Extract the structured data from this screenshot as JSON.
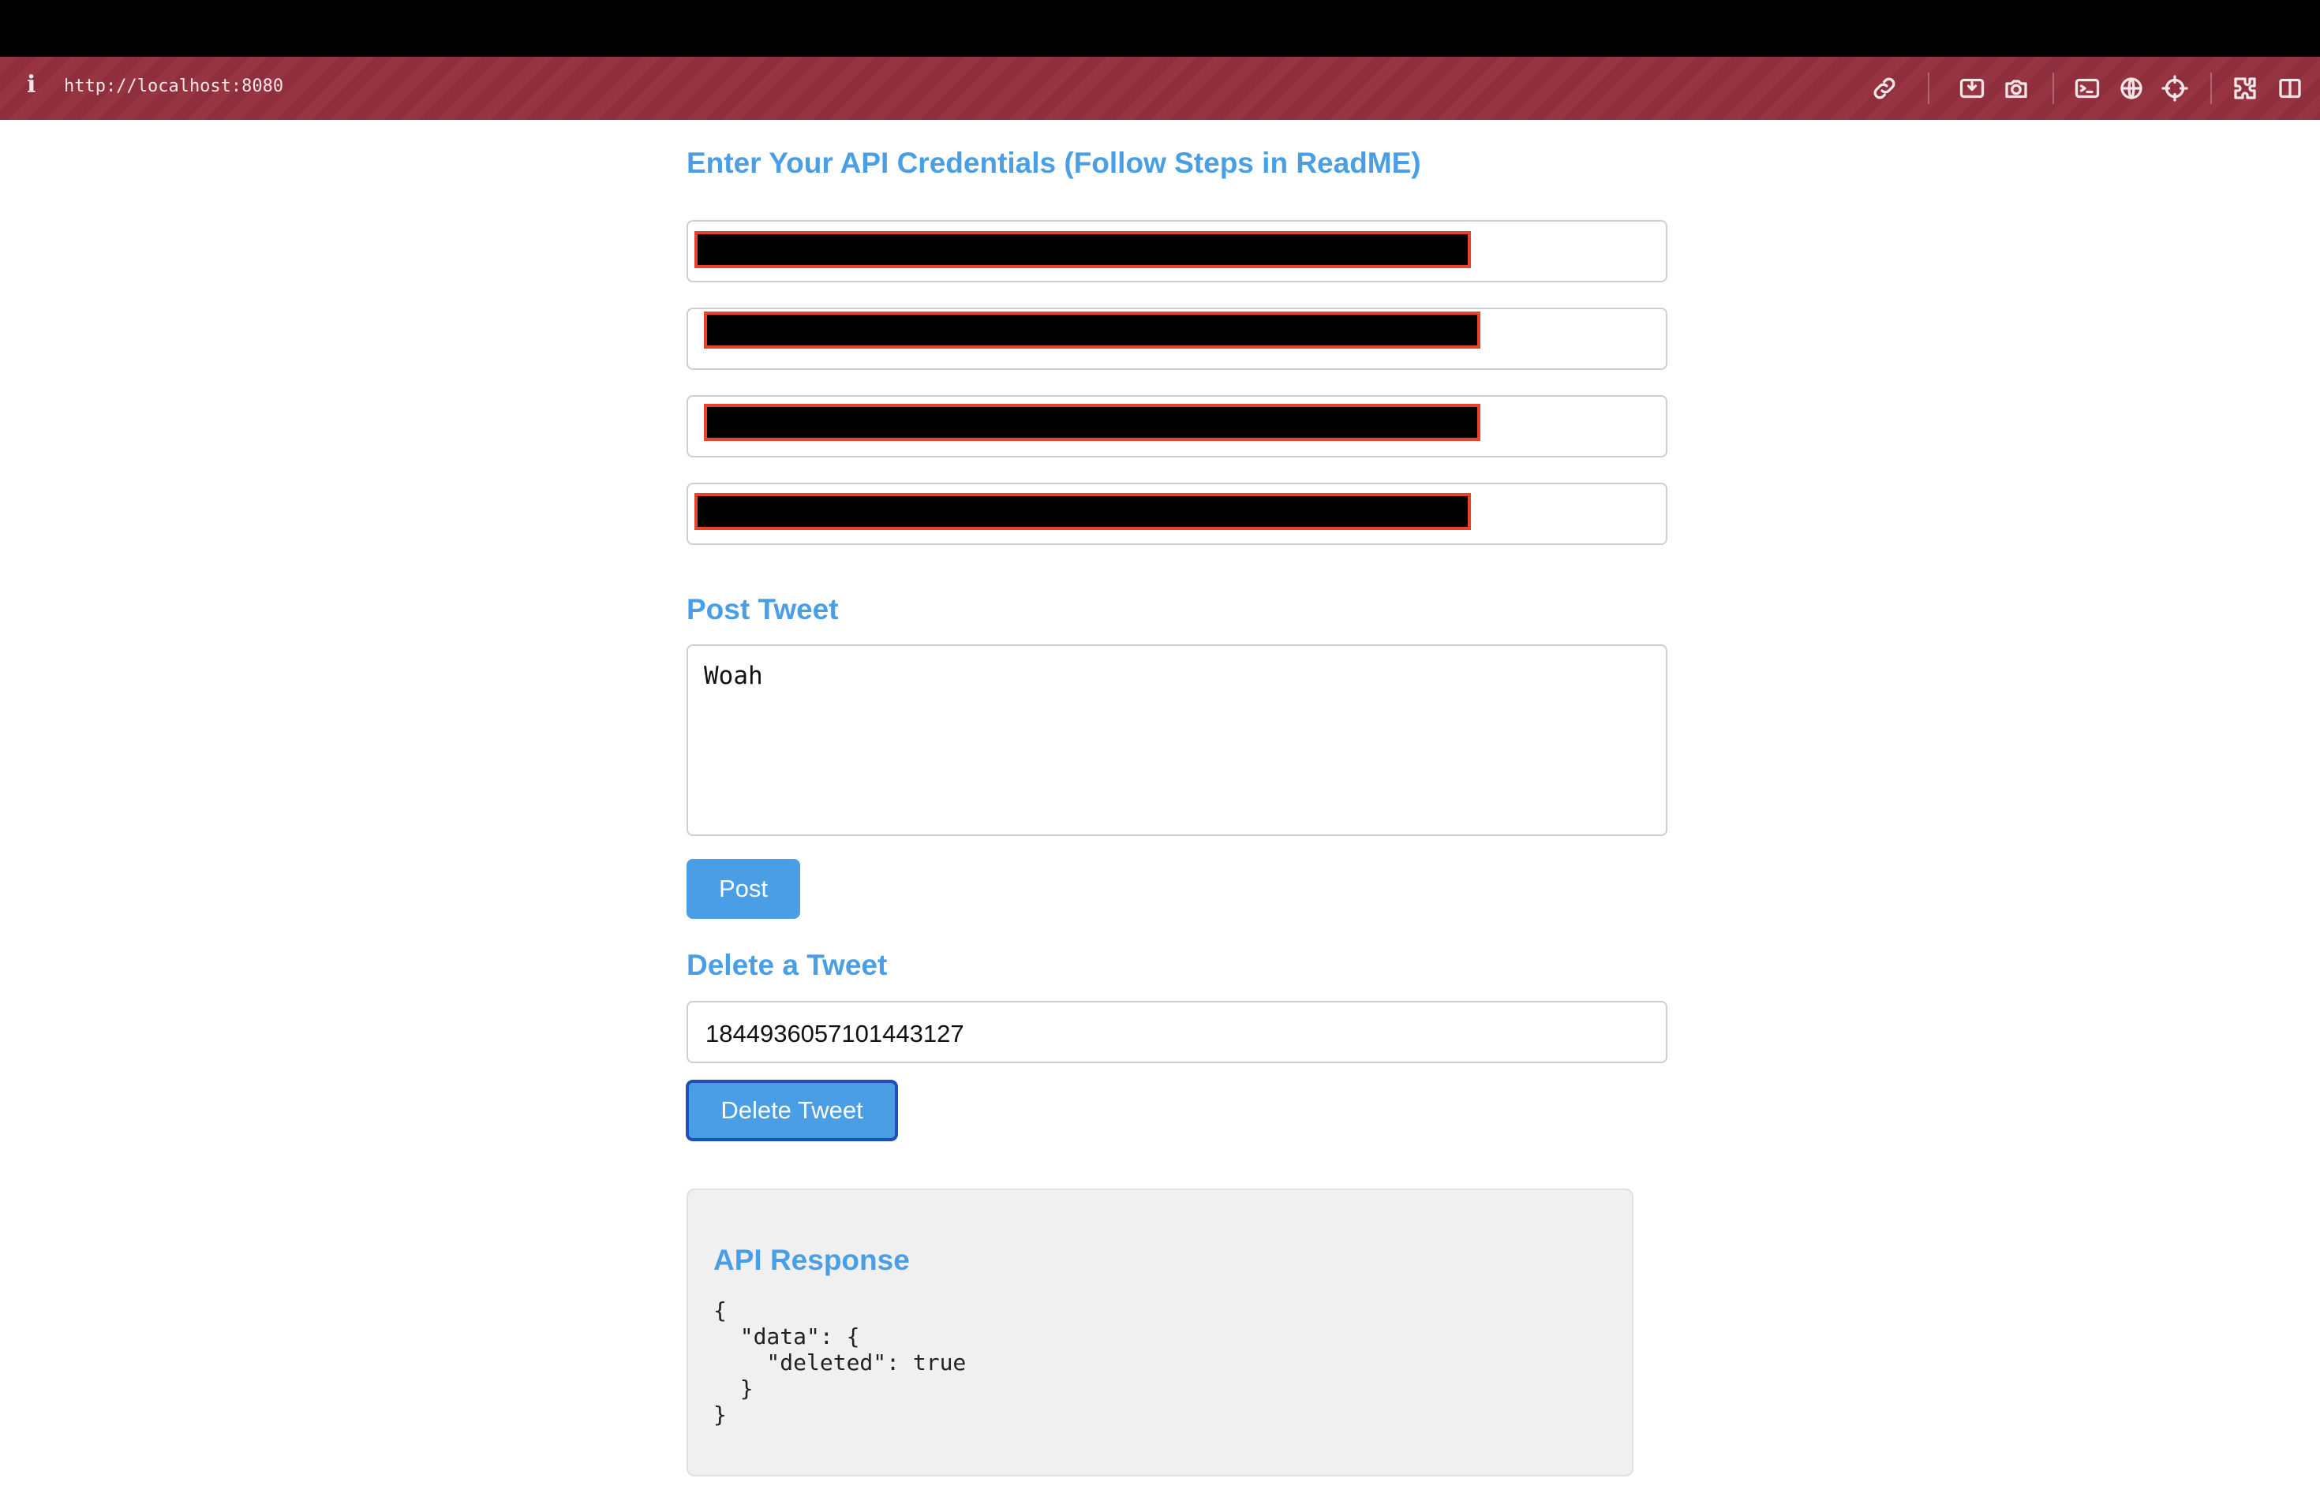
{
  "browser": {
    "url": "http://localhost:8080",
    "toolbar_icons": [
      "link-icon",
      "screenshot-area-icon",
      "camera-icon",
      "terminal-icon",
      "globe-icon",
      "crosshair-icon",
      "extensions-icon",
      "sidebar-icon"
    ]
  },
  "credentials": {
    "heading": "Enter Your API Credentials (Follow Steps in ReadME)",
    "fields_redacted": true
  },
  "post": {
    "heading": "Post Tweet",
    "textarea_value": "Woah",
    "button_label": "Post"
  },
  "delete": {
    "heading": "Delete a Tweet",
    "input_value": "1844936057101443127",
    "button_label": "Delete Tweet"
  },
  "response": {
    "heading": "API Response",
    "body": "{\n  \"data\": {\n    \"deleted\": true\n  }\n}"
  },
  "colors": {
    "accent": "#4a9ee6",
    "toolbar": "#963442",
    "redaction_border": "#e8432b"
  }
}
